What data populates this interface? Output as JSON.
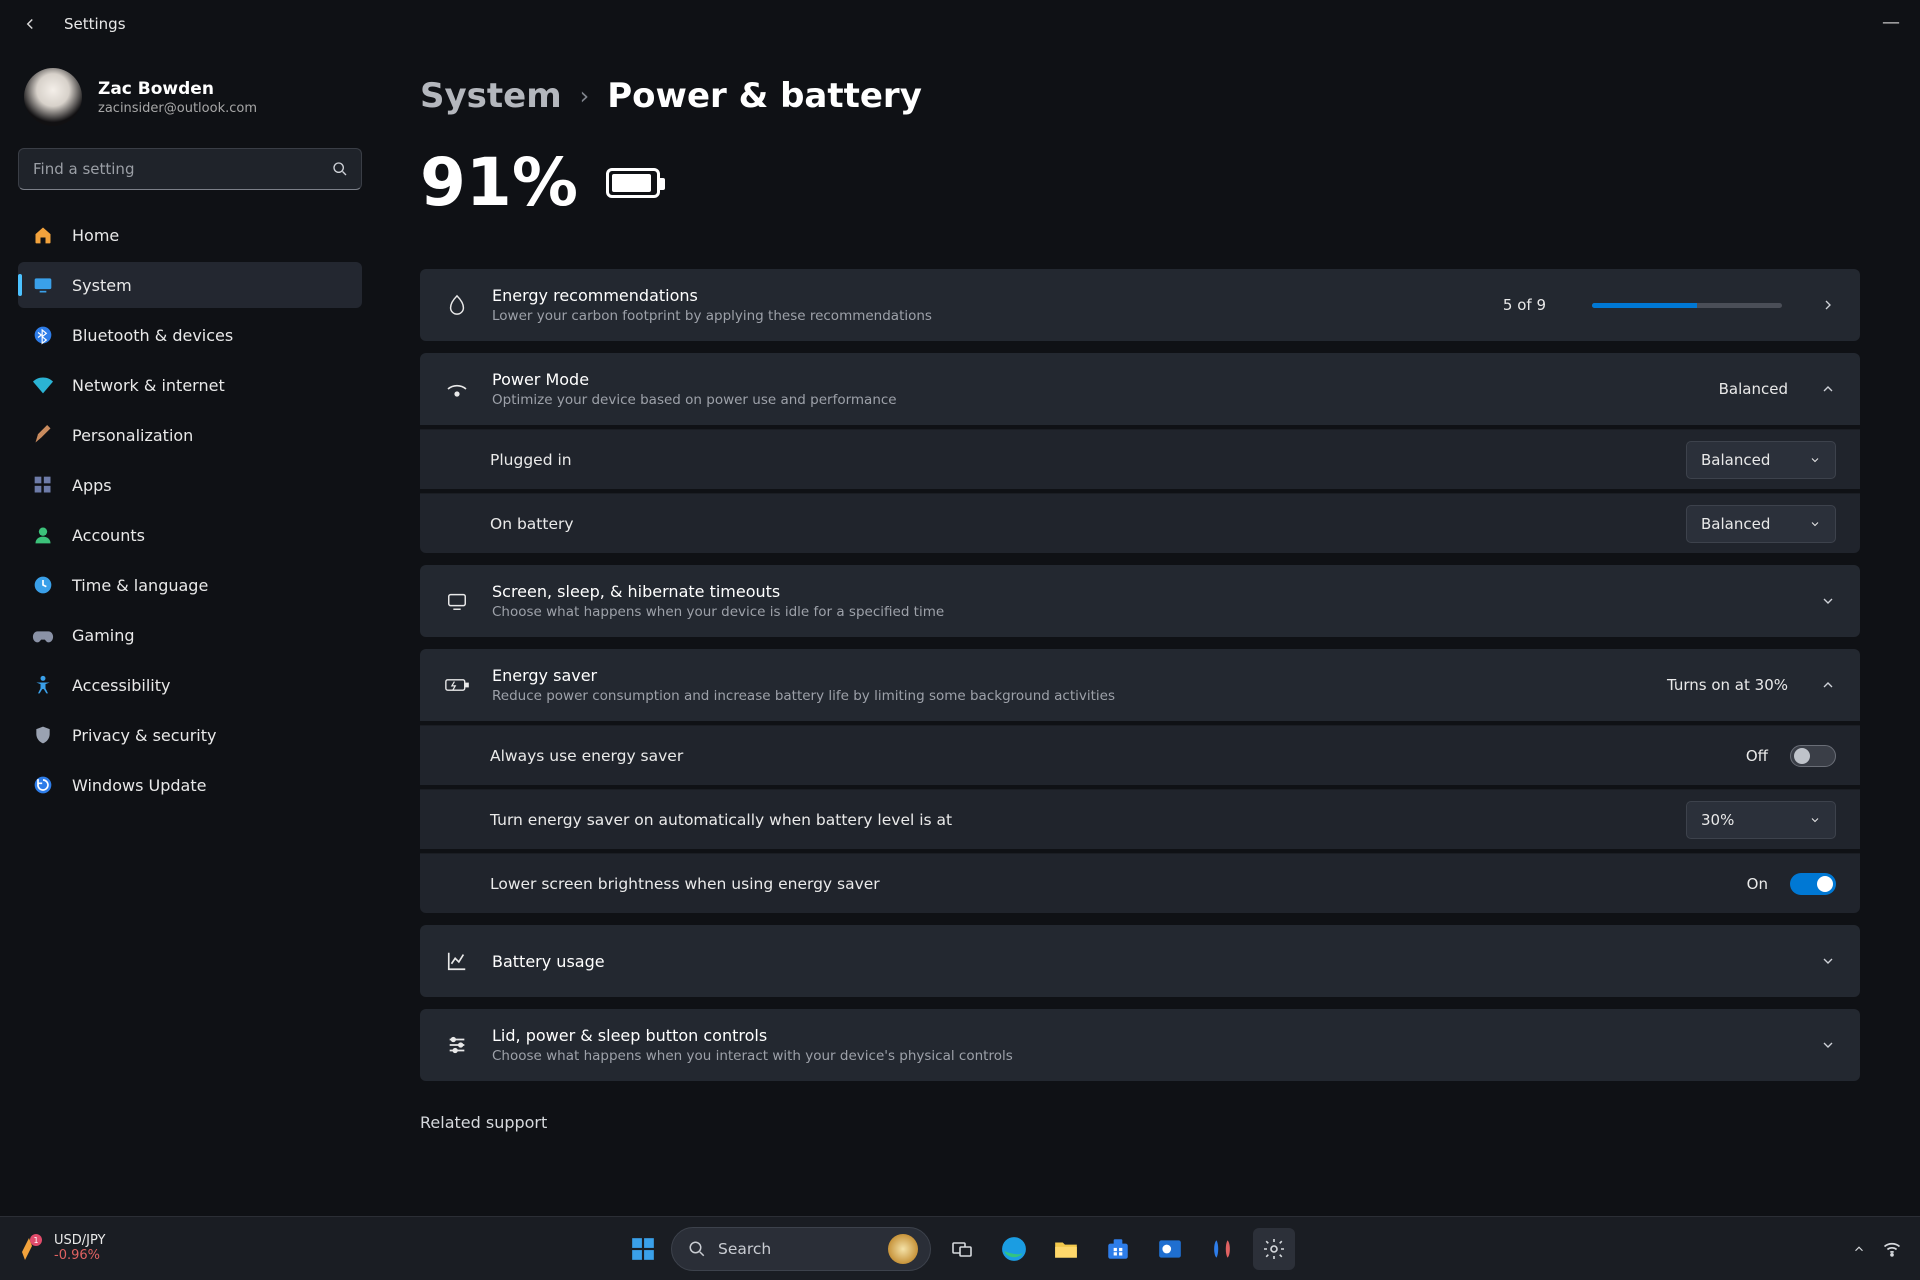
{
  "app_title": "Settings",
  "user": {
    "name": "Zac Bowden",
    "email": "zacinsider@outlook.com"
  },
  "search": {
    "placeholder": "Find a setting"
  },
  "sidebar": {
    "items": [
      {
        "label": "Home",
        "icon": "home"
      },
      {
        "label": "System",
        "icon": "system",
        "active": true
      },
      {
        "label": "Bluetooth & devices",
        "icon": "bluetooth"
      },
      {
        "label": "Network & internet",
        "icon": "network"
      },
      {
        "label": "Personalization",
        "icon": "personalization"
      },
      {
        "label": "Apps",
        "icon": "apps"
      },
      {
        "label": "Accounts",
        "icon": "accounts"
      },
      {
        "label": "Time & language",
        "icon": "time"
      },
      {
        "label": "Gaming",
        "icon": "gaming"
      },
      {
        "label": "Accessibility",
        "icon": "accessibility"
      },
      {
        "label": "Privacy & security",
        "icon": "privacy"
      },
      {
        "label": "Windows Update",
        "icon": "update"
      }
    ]
  },
  "breadcrumb": {
    "parent": "System",
    "current": "Power & battery"
  },
  "battery": {
    "percent_text": "91%",
    "fill_percent": 91
  },
  "colors": {
    "accent": "#0078d4",
    "accent_light": "#4cc2ff"
  },
  "cards": {
    "energy_rec": {
      "title": "Energy recommendations",
      "sub": "Lower your carbon footprint by applying these recommendations",
      "count_text": "5 of 9",
      "progress_pct": 55
    },
    "power_mode": {
      "title": "Power Mode",
      "sub": "Optimize your device based on power use and performance",
      "value": "Balanced",
      "rows": {
        "plugged": {
          "label": "Plugged in",
          "value": "Balanced"
        },
        "battery": {
          "label": "On battery",
          "value": "Balanced"
        }
      }
    },
    "timeouts": {
      "title": "Screen, sleep, & hibernate timeouts",
      "sub": "Choose what happens when your device is idle for a specified time"
    },
    "energy_saver": {
      "title": "Energy saver",
      "sub": "Reduce power consumption and increase battery life by limiting some background activities",
      "value": "Turns on at 30%",
      "rows": {
        "always": {
          "label": "Always use energy saver",
          "toggle_text": "Off",
          "state": "off"
        },
        "auto": {
          "label": "Turn energy saver on automatically when battery level is at",
          "value": "30%"
        },
        "dim": {
          "label": "Lower screen brightness when using energy saver",
          "toggle_text": "On",
          "state": "on"
        }
      }
    },
    "usage": {
      "title": "Battery usage"
    },
    "lid": {
      "title": "Lid, power & sleep button controls",
      "sub": "Choose what happens when you interact with your device's physical controls"
    }
  },
  "related_support_label": "Related support",
  "taskbar": {
    "widget": {
      "title": "USD/JPY",
      "delta": "-0.96%"
    },
    "search_label": "Search"
  }
}
